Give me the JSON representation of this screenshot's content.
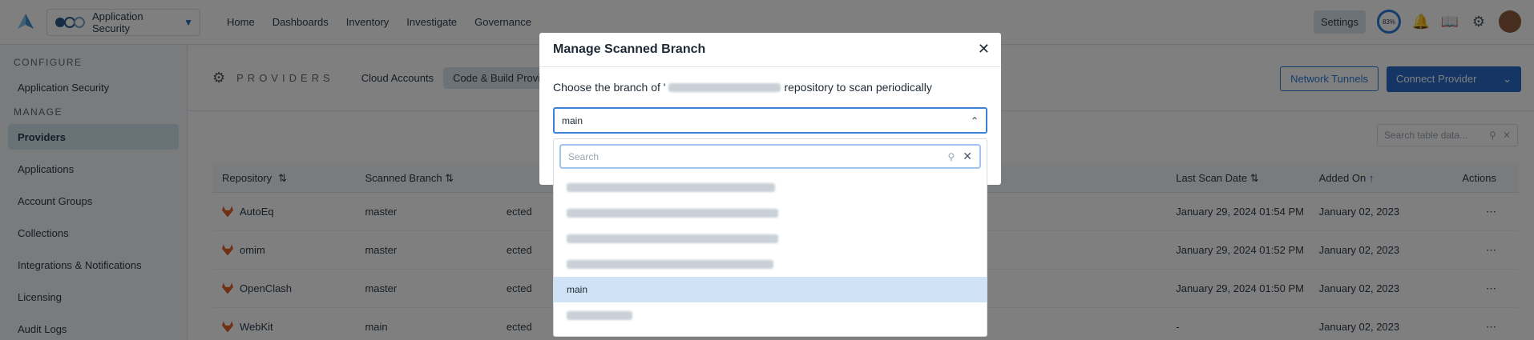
{
  "topbar": {
    "app_switcher_label": "Application Security",
    "nav": [
      "Home",
      "Dashboards",
      "Inventory",
      "Investigate",
      "Governance"
    ],
    "settings_label": "Settings",
    "progress": "83%"
  },
  "sidebar": {
    "configure_heading": "CONFIGURE",
    "configure_items": [
      "Application Security"
    ],
    "manage_heading": "MANAGE",
    "manage_items": [
      {
        "label": "Providers",
        "active": true
      },
      {
        "label": "Applications"
      },
      {
        "label": "Account Groups"
      },
      {
        "label": "Collections"
      },
      {
        "label": "Integrations & Notifications"
      },
      {
        "label": "Licensing"
      },
      {
        "label": "Audit Logs"
      }
    ]
  },
  "main": {
    "title": "PROVIDERS",
    "tabs": [
      "Cloud Accounts",
      "Code & Build Providers"
    ],
    "network_tunnels": "Network Tunnels",
    "connect_provider": "Connect Provider",
    "search_placeholder": "Search table data...",
    "columns": [
      "Repository",
      "Scanned Branch",
      "Last Scan Date",
      "Added On",
      "Actions"
    ],
    "rows": [
      {
        "repo": "AutoEq",
        "branch": "master",
        "status": "ected",
        "last_scan": "January 29, 2024 01:54 PM",
        "added": "January 02, 2023"
      },
      {
        "repo": "omim",
        "branch": "master",
        "status": "ected",
        "last_scan": "January 29, 2024 01:52 PM",
        "added": "January 02, 2023"
      },
      {
        "repo": "OpenClash",
        "branch": "master",
        "status": "ected",
        "last_scan": "January 29, 2024 01:50 PM",
        "added": "January 02, 2023"
      },
      {
        "repo": "WebKit",
        "branch": "main",
        "status": "ected",
        "last_scan": "-",
        "added": "January 02, 2023"
      }
    ]
  },
  "modal": {
    "title": "Manage Scanned Branch",
    "desc_prefix": "Choose the branch of '",
    "desc_suffix": "repository to scan periodically",
    "selected_branch": "main",
    "search_placeholder": "Search",
    "options": [
      {
        "label": "",
        "blurred": true
      },
      {
        "label": "",
        "blurred": true
      },
      {
        "label": "",
        "blurred": true
      },
      {
        "label": "",
        "blurred": true
      },
      {
        "label": "main",
        "selected": true
      },
      {
        "label": "",
        "blurred": true
      }
    ]
  },
  "colors": {
    "accent": "#2b6bc8",
    "selected_option": "#cfe2f6",
    "gitlab": "#e2612b"
  }
}
